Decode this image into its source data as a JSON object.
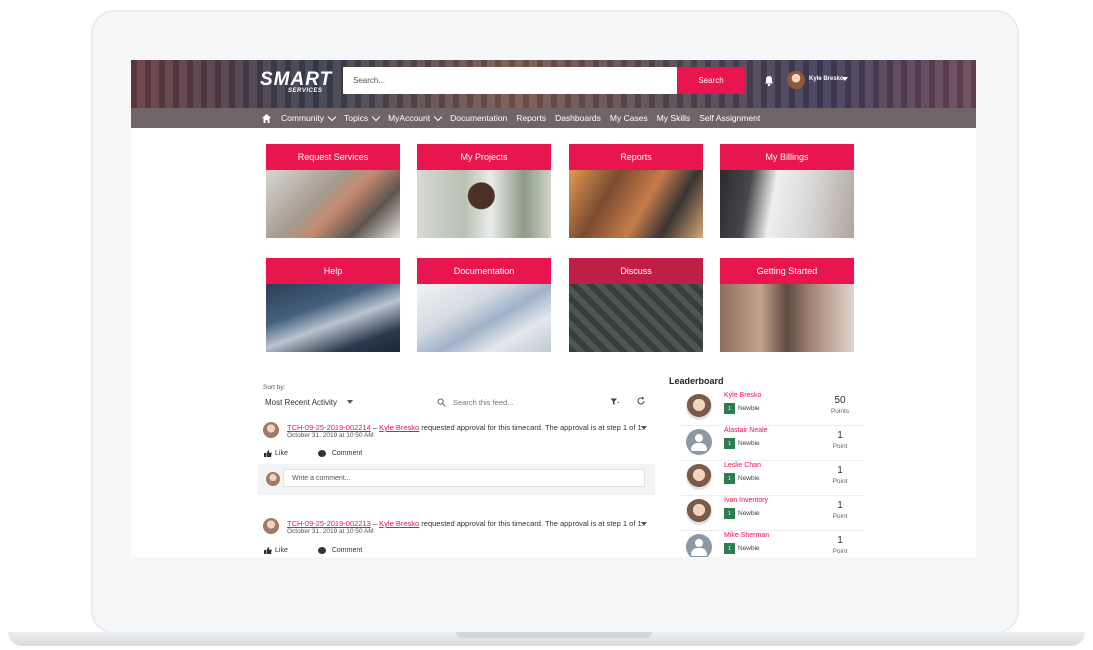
{
  "header": {
    "logo_main": "SMART",
    "logo_sub": "SERVICES",
    "search_placeholder": "Search...",
    "search_button": "Search",
    "user_name": "Kyle Bresko"
  },
  "nav": {
    "items": [
      {
        "label": "Community",
        "dropdown": true
      },
      {
        "label": "Topics",
        "dropdown": true
      },
      {
        "label": "MyAccount",
        "dropdown": true
      },
      {
        "label": "Documentation",
        "dropdown": false
      },
      {
        "label": "Reports",
        "dropdown": false
      },
      {
        "label": "Dashboards",
        "dropdown": false
      },
      {
        "label": "My Cases",
        "dropdown": false
      },
      {
        "label": "My Skills",
        "dropdown": false
      },
      {
        "label": "Self Assignment",
        "dropdown": false
      }
    ]
  },
  "tiles": [
    {
      "label": "Request Services"
    },
    {
      "label": "My Projects"
    },
    {
      "label": "Reports"
    },
    {
      "label": "My Billings"
    },
    {
      "label": "Help"
    },
    {
      "label": "Documentation"
    },
    {
      "label": "Discuss"
    },
    {
      "label": "Getting Started"
    }
  ],
  "feed": {
    "sort_label": "Sort by:",
    "sort_value": "Most Recent Activity",
    "search_placeholder": "Search this feed...",
    "posts": [
      {
        "record": "TCH-09-25-2019-002214",
        "separator": " – ",
        "author": "Kyle Bresko",
        "text": " requested approval for this timecard. The approval is at step 1 of 1.",
        "date": "October 31, 2019 at 10:50 AM"
      },
      {
        "record": "TCH-09-25-2019-002213",
        "separator": " – ",
        "author": "Kyle Bresko",
        "text": " requested approval for this timecard. The approval is at step 1 of 1.",
        "date": "October 31, 2019 at 10:50 AM"
      }
    ],
    "like_label": "Like",
    "comment_label": "Comment",
    "comment_placeholder": "Write a comment..."
  },
  "leaderboard": {
    "title": "Leaderboard",
    "entries": [
      {
        "name": "Kyle Bresko",
        "badge": "1",
        "level": "Newbie",
        "points": "50",
        "points_label": "Points",
        "avatar": "photo"
      },
      {
        "name": "Alastair Neale",
        "badge": "1",
        "level": "Newbie",
        "points": "1",
        "points_label": "Point",
        "avatar": "blank"
      },
      {
        "name": "Leslie Chan",
        "badge": "1",
        "level": "Newbie",
        "points": "1",
        "points_label": "Point",
        "avatar": "photo"
      },
      {
        "name": "Ivan Inventory",
        "badge": "1",
        "level": "Newbie",
        "points": "1",
        "points_label": "Point",
        "avatar": "photo"
      },
      {
        "name": "Mike Sherman",
        "badge": "1",
        "level": "Newbie",
        "points": "1",
        "points_label": "Point",
        "avatar": "blank"
      }
    ]
  },
  "colors": {
    "accent": "#e8154f",
    "nav_bg": "#6f6566",
    "badge": "#2f7d4f"
  }
}
